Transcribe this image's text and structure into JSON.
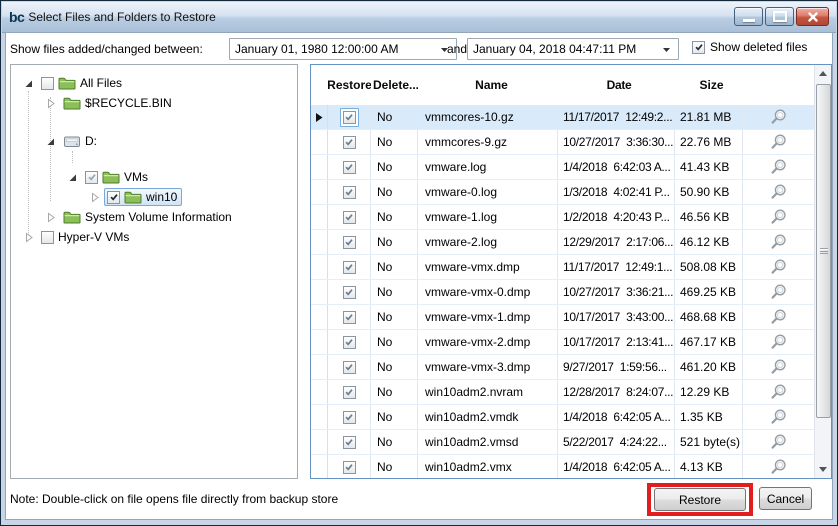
{
  "window": {
    "icon_text": "bc",
    "title": "Select Files and Folders to Restore"
  },
  "filter_bar": {
    "label": "Show files added/changed between:",
    "from_value": "January 01, 1980 12:00:00 AM",
    "and_label": "and:",
    "to_value": "January 04, 2018 04:47:11 PM",
    "show_deleted_label": "Show deleted files",
    "show_deleted_checked": true
  },
  "tree": {
    "items": [
      {
        "label": "All Files",
        "level": 0,
        "expander": "expanded",
        "checkbox": "unchecked",
        "icon": "folder",
        "selected": false
      },
      {
        "label": "$RECYCLE.BIN",
        "level": 1,
        "expander": "collapsed",
        "checkbox": "none",
        "icon": "folder",
        "selected": false
      },
      {
        "label": "D:",
        "level": 1,
        "expander": "expanded",
        "checkbox": "none",
        "icon": "drive",
        "selected": false
      },
      {
        "label": "VMs",
        "level": 2,
        "expander": "expanded",
        "checkbox": "mixed",
        "icon": "folder",
        "selected": false
      },
      {
        "label": "win10",
        "level": 3,
        "expander": "collapsed",
        "checkbox": "checked",
        "icon": "folder",
        "selected": true
      },
      {
        "label": "System Volume Information",
        "level": 1,
        "expander": "collapsed",
        "checkbox": "none",
        "icon": "folder",
        "selected": false
      },
      {
        "label": "Hyper-V VMs",
        "level": 0,
        "expander": "collapsed",
        "checkbox": "unchecked",
        "icon": "none",
        "selected": false
      }
    ]
  },
  "table": {
    "columns": [
      {
        "key": "restore",
        "label": "Restore"
      },
      {
        "key": "deleted",
        "label": "Delete..."
      },
      {
        "key": "name",
        "label": "Name"
      },
      {
        "key": "date",
        "label": "Date"
      },
      {
        "key": "size",
        "label": "Size"
      }
    ],
    "rows": [
      {
        "restore_checked": true,
        "deleted": "No",
        "name": "vmmcores-10.gz",
        "date": "11/17/2017  12:49:2...",
        "size": "21.81 MB",
        "selected": true
      },
      {
        "restore_checked": true,
        "deleted": "No",
        "name": "vmmcores-9.gz",
        "date": "10/27/2017  3:36:30...",
        "size": "22.76 MB",
        "selected": false
      },
      {
        "restore_checked": true,
        "deleted": "No",
        "name": "vmware.log",
        "date": "1/4/2018  6:42:03 A...",
        "size": "41.43 KB",
        "selected": false
      },
      {
        "restore_checked": true,
        "deleted": "No",
        "name": "vmware-0.log",
        "date": "1/3/2018  4:02:41 P...",
        "size": "50.90 KB",
        "selected": false
      },
      {
        "restore_checked": true,
        "deleted": "No",
        "name": "vmware-1.log",
        "date": "1/2/2018  4:20:43 P...",
        "size": "46.56 KB",
        "selected": false
      },
      {
        "restore_checked": true,
        "deleted": "No",
        "name": "vmware-2.log",
        "date": "12/29/2017  2:17:06...",
        "size": "46.12 KB",
        "selected": false
      },
      {
        "restore_checked": true,
        "deleted": "No",
        "name": "vmware-vmx.dmp",
        "date": "11/17/2017  12:49:1...",
        "size": "508.08 KB",
        "selected": false
      },
      {
        "restore_checked": true,
        "deleted": "No",
        "name": "vmware-vmx-0.dmp",
        "date": "10/27/2017  3:36:21...",
        "size": "469.25 KB",
        "selected": false
      },
      {
        "restore_checked": true,
        "deleted": "No",
        "name": "vmware-vmx-1.dmp",
        "date": "10/17/2017  3:43:00...",
        "size": "468.68 KB",
        "selected": false
      },
      {
        "restore_checked": true,
        "deleted": "No",
        "name": "vmware-vmx-2.dmp",
        "date": "10/17/2017  2:13:41...",
        "size": "467.17 KB",
        "selected": false
      },
      {
        "restore_checked": true,
        "deleted": "No",
        "name": "vmware-vmx-3.dmp",
        "date": "9/27/2017  1:59:56...",
        "size": "461.20 KB",
        "selected": false
      },
      {
        "restore_checked": true,
        "deleted": "No",
        "name": "win10adm2.nvram",
        "date": "12/28/2017  8:24:07...",
        "size": "12.29 KB",
        "selected": false
      },
      {
        "restore_checked": true,
        "deleted": "No",
        "name": "win10adm2.vmdk",
        "date": "1/4/2018  6:42:05 A...",
        "size": "1.35 KB",
        "selected": false
      },
      {
        "restore_checked": true,
        "deleted": "No",
        "name": "win10adm2.vmsd",
        "date": "5/22/2017  4:24:22...",
        "size": "521 byte(s)",
        "selected": false
      },
      {
        "restore_checked": true,
        "deleted": "No",
        "name": "win10adm2.vmx",
        "date": "1/4/2018  6:42:05 A...",
        "size": "4.13 KB",
        "selected": false,
        "clipped": true
      }
    ]
  },
  "footer": {
    "note": "Note: Double-click on file opens file directly from backup store",
    "restore_label": "Restore",
    "cancel_label": "Cancel"
  },
  "colors": {
    "titlebar_top": "#eef4fb",
    "titlebar_bottom": "#a9c0d8",
    "grid_border": "#6591c5",
    "row_selection": "#d9eafa",
    "tree_selection_border": "#7da7d9",
    "annotation_red": "#e11d1d",
    "folder_green": "#8bbf58",
    "close_button_red": "#c85442"
  }
}
